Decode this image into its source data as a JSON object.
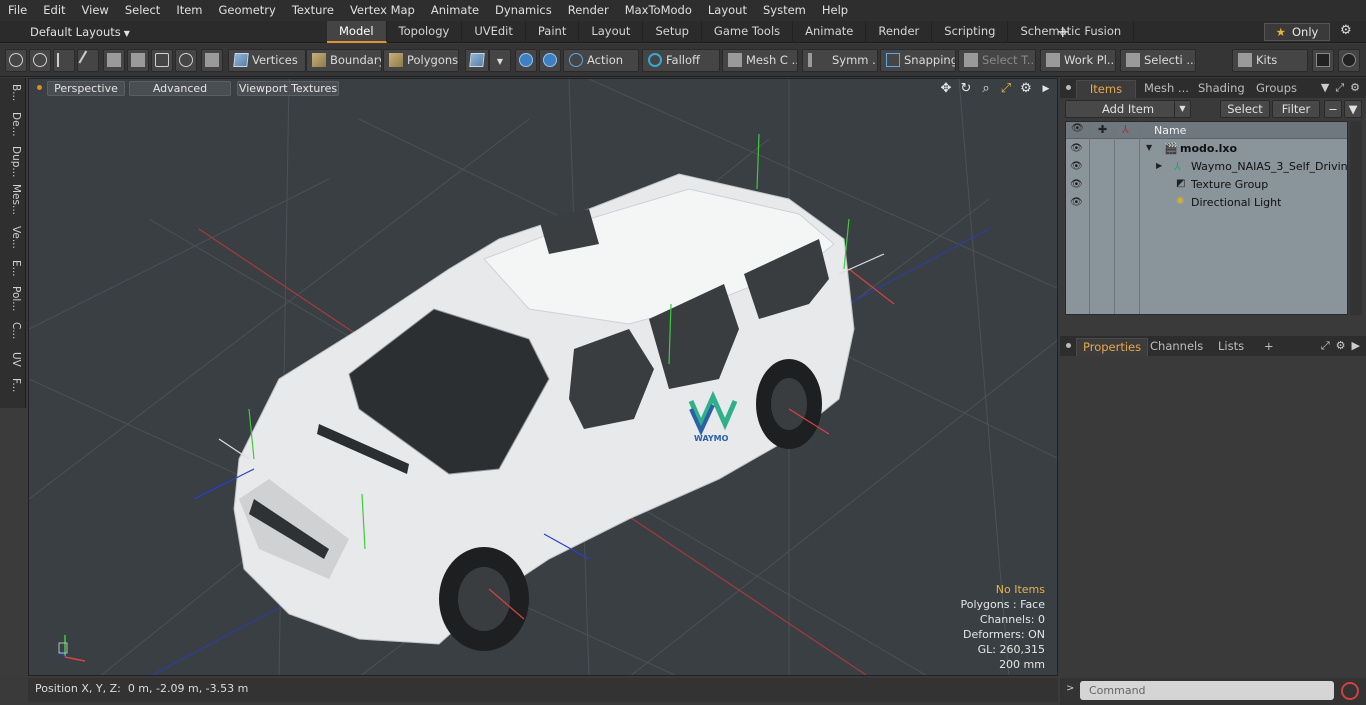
{
  "menu": [
    "File",
    "Edit",
    "View",
    "Select",
    "Item",
    "Geometry",
    "Texture",
    "Vertex Map",
    "Animate",
    "Dynamics",
    "Render",
    "MaxToModo",
    "Layout",
    "System",
    "Help"
  ],
  "layout_select": "Default Layouts",
  "layout_tabs": [
    "Model",
    "Topology",
    "UVEdit",
    "Paint",
    "Layout",
    "Setup",
    "Game Tools",
    "Animate",
    "Render",
    "Scripting",
    "Schematic Fusion"
  ],
  "active_layout_tab": "Model",
  "only_label": "Only",
  "toolbar": {
    "vertices": "Vertices",
    "boundary": "Boundary",
    "polygons": "Polygons",
    "action": "Action",
    "falloff": "Falloff",
    "mesh": "Mesh C ...",
    "symm": "Symm ...",
    "snapping": "Snapping",
    "select_t": "Select T...",
    "work_pl": "Work Pl...",
    "selecti": "Selecti ...",
    "kits": "Kits"
  },
  "left_tabs": [
    "B...",
    "De...",
    "Dup...",
    "Mes...",
    "Ve...",
    "E...",
    "Pol...",
    "C...",
    "UV",
    "F..."
  ],
  "viewport": {
    "perspective": "Perspective",
    "advanced": "Advanced",
    "textures": "Viewport Textures",
    "stats": {
      "selection": "No Items",
      "polygons": "Polygons : Face",
      "channels": "Channels: 0",
      "deformers": "Deformers: ON",
      "gl": "GL: 260,315",
      "scale": "200 mm"
    },
    "watermark": "WAYMO"
  },
  "status": {
    "label": "Position X, Y, Z:",
    "value": "0 m, -2.09 m, -3.53 m"
  },
  "items_panel": {
    "tabs": [
      "Items",
      "Mesh ...",
      "Shading",
      "Groups"
    ],
    "add_item": "Add Item",
    "select": "Select",
    "filter": "Filter",
    "name_col": "Name",
    "tree": [
      {
        "label": "modo.lxo",
        "bold": true
      },
      {
        "label": "Waymo_NAIAS_3_Self_Drivin..."
      },
      {
        "label": "Texture Group"
      },
      {
        "label": "Directional Light"
      }
    ]
  },
  "props_panel": {
    "tabs": [
      "Properties",
      "Channels",
      "Lists"
    ]
  },
  "command_placeholder": "Command",
  "colors": {
    "accent": "#e0922f",
    "viewport_bg": "#3a3f43",
    "waymo_green": "#2fb08a",
    "waymo_blue": "#2b5fa8"
  }
}
